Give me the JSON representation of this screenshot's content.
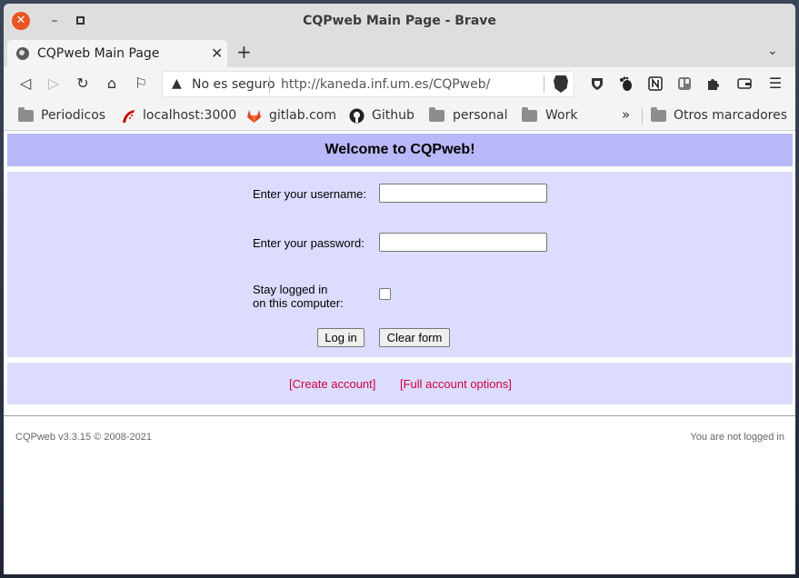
{
  "window": {
    "title": "CQPweb Main Page - Brave",
    "close_glyph": "✕",
    "minimize_glyph": "–"
  },
  "tabs": {
    "active_title": "CQPweb Main Page",
    "close_glyph": "✕",
    "new_tab_glyph": "+",
    "menu_glyph": "⌄"
  },
  "toolbar": {
    "back_glyph": "◁",
    "forward_glyph": "▷",
    "reload_glyph": "↻",
    "home_glyph": "⌂",
    "bookmark_glyph": "⚐",
    "menu_glyph": "☰",
    "warning_glyph": "▲",
    "security_label": "No es seguro",
    "url": "http://kaneda.inf.um.es/CQPweb/"
  },
  "bookmarks": {
    "items": [
      {
        "label": "Periodicos",
        "icon": "folder-icon"
      },
      {
        "label": "localhost:3000",
        "icon": "rails-icon"
      },
      {
        "label": "gitlab.com",
        "icon": "gitlab-icon"
      },
      {
        "label": "Github",
        "icon": "github-icon"
      },
      {
        "label": "personal",
        "icon": "folder-icon"
      },
      {
        "label": "Work",
        "icon": "folder-icon"
      }
    ],
    "overflow_glyph": "»",
    "other": "Otros marcadores"
  },
  "page": {
    "heading": "Welcome to CQPweb!",
    "username_label": "Enter your username:",
    "password_label": "Enter your password:",
    "stay_label_line1": "Stay logged in",
    "stay_label_line2": "on this computer:",
    "login_button": "Log in",
    "clear_button": "Clear form",
    "create_account_link": "[Create account]",
    "full_options_link": "[Full account options]",
    "footer_version": "CQPweb v3.3.15 © 2008-2021",
    "footer_status": "You are not logged in"
  },
  "colors": {
    "header_bg": "#b9b9f9",
    "panel_bg": "#dcdcff",
    "link": "#d00040",
    "close_button": "#e95420"
  }
}
